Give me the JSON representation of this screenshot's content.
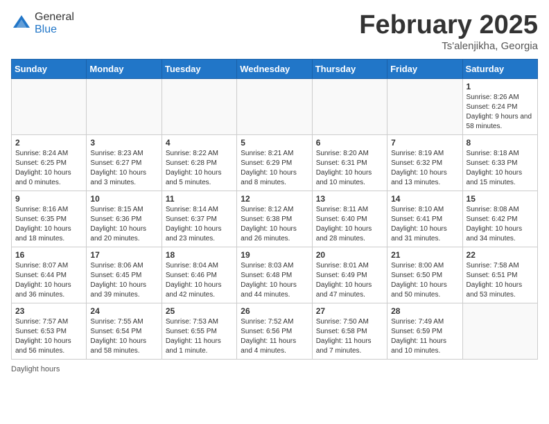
{
  "logo": {
    "general": "General",
    "blue": "Blue"
  },
  "header": {
    "month": "February 2025",
    "location": "Ts'alenjikha, Georgia"
  },
  "weekdays": [
    "Sunday",
    "Monday",
    "Tuesday",
    "Wednesday",
    "Thursday",
    "Friday",
    "Saturday"
  ],
  "weeks": [
    [
      {
        "day": "",
        "info": ""
      },
      {
        "day": "",
        "info": ""
      },
      {
        "day": "",
        "info": ""
      },
      {
        "day": "",
        "info": ""
      },
      {
        "day": "",
        "info": ""
      },
      {
        "day": "",
        "info": ""
      },
      {
        "day": "1",
        "info": "Sunrise: 8:26 AM\nSunset: 6:24 PM\nDaylight: 9 hours and 58 minutes."
      }
    ],
    [
      {
        "day": "2",
        "info": "Sunrise: 8:24 AM\nSunset: 6:25 PM\nDaylight: 10 hours and 0 minutes."
      },
      {
        "day": "3",
        "info": "Sunrise: 8:23 AM\nSunset: 6:27 PM\nDaylight: 10 hours and 3 minutes."
      },
      {
        "day": "4",
        "info": "Sunrise: 8:22 AM\nSunset: 6:28 PM\nDaylight: 10 hours and 5 minutes."
      },
      {
        "day": "5",
        "info": "Sunrise: 8:21 AM\nSunset: 6:29 PM\nDaylight: 10 hours and 8 minutes."
      },
      {
        "day": "6",
        "info": "Sunrise: 8:20 AM\nSunset: 6:31 PM\nDaylight: 10 hours and 10 minutes."
      },
      {
        "day": "7",
        "info": "Sunrise: 8:19 AM\nSunset: 6:32 PM\nDaylight: 10 hours and 13 minutes."
      },
      {
        "day": "8",
        "info": "Sunrise: 8:18 AM\nSunset: 6:33 PM\nDaylight: 10 hours and 15 minutes."
      }
    ],
    [
      {
        "day": "9",
        "info": "Sunrise: 8:16 AM\nSunset: 6:35 PM\nDaylight: 10 hours and 18 minutes."
      },
      {
        "day": "10",
        "info": "Sunrise: 8:15 AM\nSunset: 6:36 PM\nDaylight: 10 hours and 20 minutes."
      },
      {
        "day": "11",
        "info": "Sunrise: 8:14 AM\nSunset: 6:37 PM\nDaylight: 10 hours and 23 minutes."
      },
      {
        "day": "12",
        "info": "Sunrise: 8:12 AM\nSunset: 6:38 PM\nDaylight: 10 hours and 26 minutes."
      },
      {
        "day": "13",
        "info": "Sunrise: 8:11 AM\nSunset: 6:40 PM\nDaylight: 10 hours and 28 minutes."
      },
      {
        "day": "14",
        "info": "Sunrise: 8:10 AM\nSunset: 6:41 PM\nDaylight: 10 hours and 31 minutes."
      },
      {
        "day": "15",
        "info": "Sunrise: 8:08 AM\nSunset: 6:42 PM\nDaylight: 10 hours and 34 minutes."
      }
    ],
    [
      {
        "day": "16",
        "info": "Sunrise: 8:07 AM\nSunset: 6:44 PM\nDaylight: 10 hours and 36 minutes."
      },
      {
        "day": "17",
        "info": "Sunrise: 8:06 AM\nSunset: 6:45 PM\nDaylight: 10 hours and 39 minutes."
      },
      {
        "day": "18",
        "info": "Sunrise: 8:04 AM\nSunset: 6:46 PM\nDaylight: 10 hours and 42 minutes."
      },
      {
        "day": "19",
        "info": "Sunrise: 8:03 AM\nSunset: 6:48 PM\nDaylight: 10 hours and 44 minutes."
      },
      {
        "day": "20",
        "info": "Sunrise: 8:01 AM\nSunset: 6:49 PM\nDaylight: 10 hours and 47 minutes."
      },
      {
        "day": "21",
        "info": "Sunrise: 8:00 AM\nSunset: 6:50 PM\nDaylight: 10 hours and 50 minutes."
      },
      {
        "day": "22",
        "info": "Sunrise: 7:58 AM\nSunset: 6:51 PM\nDaylight: 10 hours and 53 minutes."
      }
    ],
    [
      {
        "day": "23",
        "info": "Sunrise: 7:57 AM\nSunset: 6:53 PM\nDaylight: 10 hours and 56 minutes."
      },
      {
        "day": "24",
        "info": "Sunrise: 7:55 AM\nSunset: 6:54 PM\nDaylight: 10 hours and 58 minutes."
      },
      {
        "day": "25",
        "info": "Sunrise: 7:53 AM\nSunset: 6:55 PM\nDaylight: 11 hours and 1 minute."
      },
      {
        "day": "26",
        "info": "Sunrise: 7:52 AM\nSunset: 6:56 PM\nDaylight: 11 hours and 4 minutes."
      },
      {
        "day": "27",
        "info": "Sunrise: 7:50 AM\nSunset: 6:58 PM\nDaylight: 11 hours and 7 minutes."
      },
      {
        "day": "28",
        "info": "Sunrise: 7:49 AM\nSunset: 6:59 PM\nDaylight: 11 hours and 10 minutes."
      },
      {
        "day": "",
        "info": ""
      }
    ]
  ],
  "footer": {
    "note": "Daylight hours"
  }
}
